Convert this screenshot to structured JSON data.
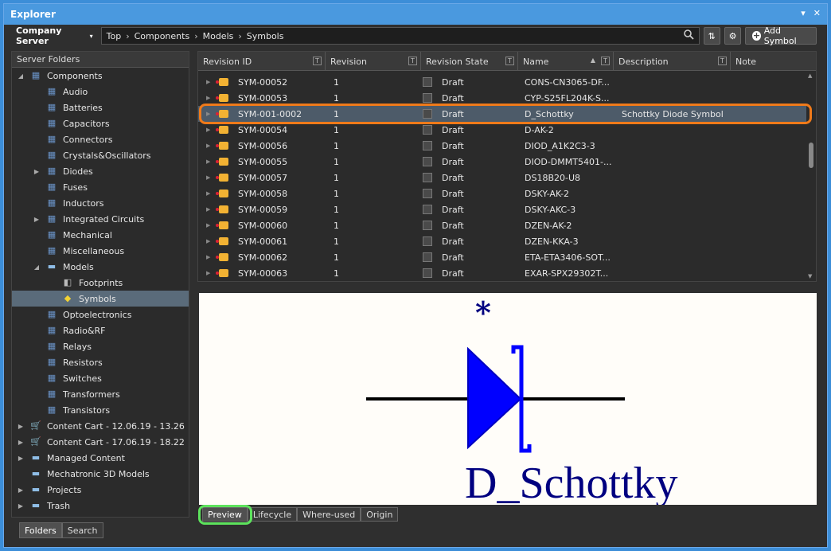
{
  "window": {
    "title": "Explorer"
  },
  "toolbar": {
    "server": "Company Server",
    "breadcrumbs": [
      "Top",
      "Components",
      "Models",
      "Symbols"
    ],
    "add_symbol": "Add Symbol"
  },
  "left_panel": {
    "header": "Server Folders",
    "tree": [
      {
        "label": "Components",
        "level": 0,
        "icon": "chip",
        "expanded": true
      },
      {
        "label": "Audio",
        "level": 1,
        "icon": "chip"
      },
      {
        "label": "Batteries",
        "level": 1,
        "icon": "chip"
      },
      {
        "label": "Capacitors",
        "level": 1,
        "icon": "chip"
      },
      {
        "label": "Connectors",
        "level": 1,
        "icon": "chip"
      },
      {
        "label": "Crystals&Oscillators",
        "level": 1,
        "icon": "chip"
      },
      {
        "label": "Diodes",
        "level": 1,
        "icon": "chip",
        "collapsed": true
      },
      {
        "label": "Fuses",
        "level": 1,
        "icon": "chip"
      },
      {
        "label": "Inductors",
        "level": 1,
        "icon": "chip"
      },
      {
        "label": "Integrated Circuits",
        "level": 1,
        "icon": "chip",
        "collapsed": true
      },
      {
        "label": "Mechanical",
        "level": 1,
        "icon": "chip"
      },
      {
        "label": "Miscellaneous",
        "level": 1,
        "icon": "chip"
      },
      {
        "label": "Models",
        "level": 1,
        "icon": "folder",
        "expanded": true
      },
      {
        "label": "Footprints",
        "level": 2,
        "icon": "footprint"
      },
      {
        "label": "Symbols",
        "level": 2,
        "icon": "symbol",
        "selected": true
      },
      {
        "label": "Optoelectronics",
        "level": 1,
        "icon": "chip"
      },
      {
        "label": "Radio&RF",
        "level": 1,
        "icon": "chip"
      },
      {
        "label": "Relays",
        "level": 1,
        "icon": "chip"
      },
      {
        "label": "Resistors",
        "level": 1,
        "icon": "chip"
      },
      {
        "label": "Switches",
        "level": 1,
        "icon": "chip"
      },
      {
        "label": "Transformers",
        "level": 1,
        "icon": "chip"
      },
      {
        "label": "Transistors",
        "level": 1,
        "icon": "chip"
      },
      {
        "label": "Content Cart - 12.06.19 - 13.26",
        "level": 0,
        "icon": "cart",
        "collapsed": true
      },
      {
        "label": "Content Cart - 17.06.19 - 18.22",
        "level": 0,
        "icon": "cart",
        "collapsed": true
      },
      {
        "label": "Managed Content",
        "level": 0,
        "icon": "folder",
        "collapsed": true
      },
      {
        "label": "Mechatronic 3D Models",
        "level": 0,
        "icon": "folder"
      },
      {
        "label": "Projects",
        "level": 0,
        "icon": "folder",
        "collapsed": true
      },
      {
        "label": "Trash",
        "level": 0,
        "icon": "folder",
        "collapsed": true
      }
    ],
    "tabs": [
      "Folders",
      "Search"
    ]
  },
  "grid": {
    "columns": [
      "Revision ID",
      "Revision",
      "Revision State",
      "Name",
      "Description",
      "Note"
    ],
    "filter_glyph": "T",
    "rows": [
      {
        "id": "SYM-00052",
        "rev": "1",
        "state": "Draft",
        "name": "CONS-CN3065-DF...",
        "desc": ""
      },
      {
        "id": "SYM-00053",
        "rev": "1",
        "state": "Draft",
        "name": "CYP-S25FL204K-S...",
        "desc": ""
      },
      {
        "id": "SYM-001-0002",
        "rev": "1",
        "state": "Draft",
        "name": "D_Schottky",
        "desc": "Schottky Diode Symbol",
        "selected": true
      },
      {
        "id": "SYM-00054",
        "rev": "1",
        "state": "Draft",
        "name": "D-AK-2",
        "desc": ""
      },
      {
        "id": "SYM-00056",
        "rev": "1",
        "state": "Draft",
        "name": "DIOD_A1K2C3-3",
        "desc": ""
      },
      {
        "id": "SYM-00055",
        "rev": "1",
        "state": "Draft",
        "name": "DIOD-DMMT5401-...",
        "desc": ""
      },
      {
        "id": "SYM-00057",
        "rev": "1",
        "state": "Draft",
        "name": "DS18B20-U8",
        "desc": ""
      },
      {
        "id": "SYM-00058",
        "rev": "1",
        "state": "Draft",
        "name": "DSKY-AK-2",
        "desc": ""
      },
      {
        "id": "SYM-00059",
        "rev": "1",
        "state": "Draft",
        "name": "DSKY-AKC-3",
        "desc": ""
      },
      {
        "id": "SYM-00060",
        "rev": "1",
        "state": "Draft",
        "name": "DZEN-AK-2",
        "desc": ""
      },
      {
        "id": "SYM-00061",
        "rev": "1",
        "state": "Draft",
        "name": "DZEN-KKA-3",
        "desc": ""
      },
      {
        "id": "SYM-00062",
        "rev": "1",
        "state": "Draft",
        "name": "ETA-ETA3406-SOT...",
        "desc": ""
      },
      {
        "id": "SYM-00063",
        "rev": "1",
        "state": "Draft",
        "name": "EXAR-SPX29302T...",
        "desc": ""
      }
    ]
  },
  "preview": {
    "designator": "*",
    "component_name": "D_Schottky",
    "colors": {
      "body": "#0000ff",
      "text": "#000080",
      "wire": "#000000",
      "background": "#fffdf9"
    }
  },
  "preview_tabs": [
    "Preview",
    "Lifecycle",
    "Where-used",
    "Origin"
  ],
  "highlights": {
    "orange": "#ef7a1a",
    "green": "#5de35d"
  }
}
